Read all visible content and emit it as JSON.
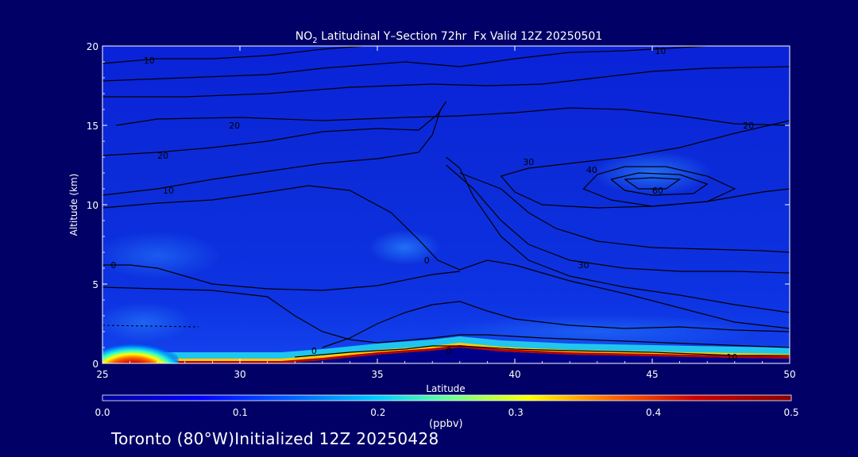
{
  "chart_data": {
    "type": "heatmap",
    "title_prefix": "NO",
    "title_sub": "2",
    "title_rest": " Latitudinal Y–Section 72hr  Fx Valid 12Z 20250501",
    "xlabel": "Latitude",
    "ylabel": "Altitude (km)",
    "xlim": [
      25,
      50
    ],
    "ylim": [
      0,
      20
    ],
    "x_ticks": [
      25,
      30,
      35,
      40,
      45,
      50
    ],
    "y_ticks": [
      0,
      5,
      10,
      15,
      20
    ],
    "grid": false,
    "colorbar": {
      "unit": "(ppbv)",
      "range": [
        0.0,
        0.5
      ],
      "ticks": [
        "0.0",
        "0.1",
        "0.2",
        "0.3",
        "0.4",
        "0.5"
      ],
      "colors": [
        "#000099",
        "#0000ff",
        "#0066ff",
        "#00ccff",
        "#66ff99",
        "#ffff00",
        "#ff6600",
        "#cc0000",
        "#880000"
      ]
    },
    "terrain_top_km": [
      {
        "lat": 25,
        "alt": 0.0
      },
      {
        "lat": 31.5,
        "alt": 0.0
      },
      {
        "lat": 33,
        "alt": 0.2
      },
      {
        "lat": 35,
        "alt": 0.55
      },
      {
        "lat": 37,
        "alt": 0.8
      },
      {
        "lat": 38,
        "alt": 1.0
      },
      {
        "lat": 39.5,
        "alt": 0.75
      },
      {
        "lat": 42,
        "alt": 0.55
      },
      {
        "lat": 45,
        "alt": 0.45
      },
      {
        "lat": 48,
        "alt": 0.35
      },
      {
        "lat": 50,
        "alt": 0.3
      }
    ],
    "hotspots": [
      {
        "lat": 26.1,
        "alt": 0.3,
        "value": 0.5,
        "label": "surface max near 26N"
      },
      {
        "lat": 45.0,
        "alt": 11.7,
        "value": 0.12,
        "label": "upper-level enhancement"
      },
      {
        "lat": 36.0,
        "alt": 7.2,
        "value": 0.1,
        "label": "mid-level plume"
      }
    ],
    "contour_labels": [
      {
        "text": "10",
        "lat": 26.7,
        "alt": 19.1
      },
      {
        "text": "10",
        "lat": 45.3,
        "alt": 19.7
      },
      {
        "text": "20",
        "lat": 29.8,
        "alt": 15.0
      },
      {
        "text": "20",
        "lat": 48.5,
        "alt": 15.0
      },
      {
        "text": "20",
        "lat": 27.2,
        "alt": 13.1
      },
      {
        "text": "10",
        "lat": 27.4,
        "alt": 10.9
      },
      {
        "text": "30",
        "lat": 40.5,
        "alt": 12.7
      },
      {
        "text": "40",
        "lat": 42.8,
        "alt": 12.2
      },
      {
        "text": "60",
        "lat": 45.2,
        "alt": 10.9
      },
      {
        "text": "30",
        "lat": 42.5,
        "alt": 6.2
      },
      {
        "text": "0",
        "lat": 25.4,
        "alt": 6.2
      },
      {
        "text": "0",
        "lat": 32.7,
        "alt": 0.8
      },
      {
        "text": "0",
        "lat": 37.6,
        "alt": 0.8
      },
      {
        "text": "10",
        "lat": 47.9,
        "alt": 0.4
      },
      {
        "text": "0",
        "lat": 36.8,
        "alt": 6.5
      }
    ],
    "contours": [
      [
        [
          25,
          18.9
        ],
        [
          27,
          19.2
        ],
        [
          29,
          19.2
        ],
        [
          31,
          19.4
        ],
        [
          33,
          19.8
        ],
        [
          34.5,
          20
        ]
      ],
      [
        [
          25,
          17.8
        ],
        [
          28,
          18.0
        ],
        [
          31,
          18.2
        ],
        [
          33,
          18.6
        ],
        [
          36,
          19.0
        ],
        [
          38,
          18.7
        ],
        [
          40,
          19.2
        ],
        [
          42,
          19.6
        ],
        [
          44,
          19.7
        ],
        [
          46,
          19.9
        ],
        [
          47,
          20
        ]
      ],
      [
        [
          25,
          16.8
        ],
        [
          28,
          16.8
        ],
        [
          31,
          17.0
        ],
        [
          34,
          17.4
        ],
        [
          37,
          17.6
        ],
        [
          39,
          17.5
        ],
        [
          41,
          17.6
        ],
        [
          43,
          18.0
        ],
        [
          45,
          18.4
        ],
        [
          47,
          18.6
        ],
        [
          50,
          18.7
        ]
      ],
      [
        [
          25.5,
          15.0
        ],
        [
          27,
          15.4
        ],
        [
          30,
          15.5
        ],
        [
          33,
          15.3
        ],
        [
          36,
          15.5
        ],
        [
          38,
          15.6
        ],
        [
          40,
          15.8
        ],
        [
          42,
          16.1
        ],
        [
          44,
          16.0
        ],
        [
          46,
          15.6
        ],
        [
          48,
          15.1
        ],
        [
          50,
          15.0
        ]
      ],
      [
        [
          25,
          13.1
        ],
        [
          27,
          13.3
        ],
        [
          29,
          13.6
        ],
        [
          31,
          14.0
        ],
        [
          33,
          14.6
        ],
        [
          35,
          14.8
        ],
        [
          36.5,
          14.7
        ],
        [
          37.2,
          15.7
        ],
        [
          37.5,
          16.5
        ]
      ],
      [
        [
          25,
          10.6
        ],
        [
          27,
          11.0
        ],
        [
          29,
          11.6
        ],
        [
          31,
          12.1
        ],
        [
          33,
          12.6
        ],
        [
          35,
          12.9
        ],
        [
          36.5,
          13.3
        ],
        [
          37,
          14.4
        ],
        [
          37.3,
          16.0
        ]
      ],
      [
        [
          25,
          9.8
        ],
        [
          27,
          10.1
        ],
        [
          29,
          10.3
        ],
        [
          31,
          10.8
        ],
        [
          32.5,
          11.2
        ],
        [
          34,
          10.9
        ],
        [
          35.5,
          9.5
        ],
        [
          36.5,
          7.8
        ],
        [
          37.2,
          6.5
        ],
        [
          38,
          5.9
        ],
        [
          39,
          6.5
        ],
        [
          40,
          6.2
        ],
        [
          42,
          5.2
        ],
        [
          44,
          4.4
        ],
        [
          46,
          3.5
        ],
        [
          48,
          2.6
        ],
        [
          50,
          2.2
        ]
      ],
      [
        [
          38,
          12.0
        ],
        [
          39.5,
          11.0
        ],
        [
          40.5,
          9.5
        ],
        [
          41.5,
          8.5
        ],
        [
          43,
          7.7
        ],
        [
          45,
          7.3
        ],
        [
          47,
          7.2
        ],
        [
          49,
          7.1
        ],
        [
          50,
          7.0
        ]
      ],
      [
        [
          37.5,
          12.5
        ],
        [
          38.5,
          11.0
        ],
        [
          39.5,
          9.0
        ],
        [
          40.5,
          7.5
        ],
        [
          42,
          6.5
        ],
        [
          44,
          6.0
        ],
        [
          46,
          5.8
        ],
        [
          48,
          5.8
        ],
        [
          50,
          5.7
        ]
      ],
      [
        [
          37.5,
          13.0
        ],
        [
          38,
          12.3
        ],
        [
          38.5,
          10.5
        ],
        [
          39.5,
          8.0
        ],
        [
          40.5,
          6.5
        ],
        [
          42,
          5.5
        ],
        [
          44,
          4.8
        ],
        [
          46,
          4.3
        ],
        [
          48,
          3.7
        ],
        [
          50,
          3.2
        ]
      ],
      [
        [
          50,
          15.3
        ],
        [
          48,
          14.5
        ],
        [
          46,
          13.6
        ],
        [
          44,
          13.0
        ],
        [
          42,
          12.6
        ],
        [
          40.5,
          12.3
        ],
        [
          39.5,
          11.8
        ],
        [
          40,
          10.8
        ],
        [
          41,
          10.0
        ],
        [
          43,
          9.8
        ],
        [
          45,
          9.9
        ],
        [
          47,
          10.2
        ],
        [
          49,
          10.8
        ],
        [
          50,
          11.0
        ]
      ],
      [
        [
          43,
          11.9
        ],
        [
          44,
          12.4
        ],
        [
          45.5,
          12.4
        ],
        [
          47,
          11.8
        ],
        [
          48,
          11.0
        ],
        [
          47,
          10.2
        ],
        [
          45,
          9.9
        ],
        [
          43.5,
          10.3
        ],
        [
          42.5,
          11.0
        ],
        [
          43,
          11.9
        ]
      ],
      [
        [
          43.5,
          11.6
        ],
        [
          44.5,
          12.0
        ],
        [
          46,
          11.9
        ],
        [
          47,
          11.3
        ],
        [
          46.5,
          10.7
        ],
        [
          45,
          10.6
        ],
        [
          44,
          10.9
        ],
        [
          43.5,
          11.6
        ]
      ],
      [
        [
          44,
          11.6
        ],
        [
          45,
          11.7
        ],
        [
          46,
          11.6
        ],
        [
          45.5,
          11.0
        ],
        [
          44.5,
          11.0
        ],
        [
          44,
          11.6
        ]
      ],
      [
        [
          25,
          6.2
        ],
        [
          26,
          6.2
        ],
        [
          27,
          6.0
        ],
        [
          28,
          5.5
        ],
        [
          29,
          5.0
        ],
        [
          31,
          4.7
        ],
        [
          33,
          4.6
        ],
        [
          35,
          4.9
        ],
        [
          37,
          5.6
        ],
        [
          38,
          5.8
        ]
      ],
      [
        [
          25,
          4.8
        ],
        [
          27,
          4.7
        ],
        [
          29,
          4.6
        ],
        [
          31,
          4.2
        ],
        [
          32,
          3.0
        ],
        [
          33,
          2.0
        ],
        [
          34,
          1.5
        ],
        [
          35,
          1.3
        ],
        [
          37,
          1.6
        ],
        [
          38,
          1.8
        ],
        [
          39,
          1.8
        ],
        [
          41,
          1.6
        ],
        [
          44,
          1.4
        ],
        [
          47,
          1.2
        ],
        [
          50,
          1.0
        ]
      ],
      [
        [
          32,
          0.4
        ],
        [
          34,
          0.7
        ],
        [
          36,
          0.9
        ],
        [
          37,
          1.1
        ],
        [
          38,
          1.1
        ],
        [
          40,
          0.9
        ],
        [
          42,
          0.8
        ],
        [
          45,
          0.7
        ],
        [
          48,
          0.5
        ],
        [
          50,
          0.5
        ]
      ],
      [
        [
          33,
          1.0
        ],
        [
          34,
          1.6
        ],
        [
          35,
          2.5
        ],
        [
          36,
          3.2
        ],
        [
          37,
          3.7
        ],
        [
          38,
          3.9
        ],
        [
          39,
          3.3
        ],
        [
          40,
          2.8
        ],
        [
          42,
          2.4
        ],
        [
          44,
          2.2
        ],
        [
          46,
          2.3
        ],
        [
          48,
          2.1
        ],
        [
          50,
          2.0
        ]
      ]
    ]
  },
  "footer": {
    "location_line": "Toronto (80°W)Initialized 12Z 20250428"
  }
}
